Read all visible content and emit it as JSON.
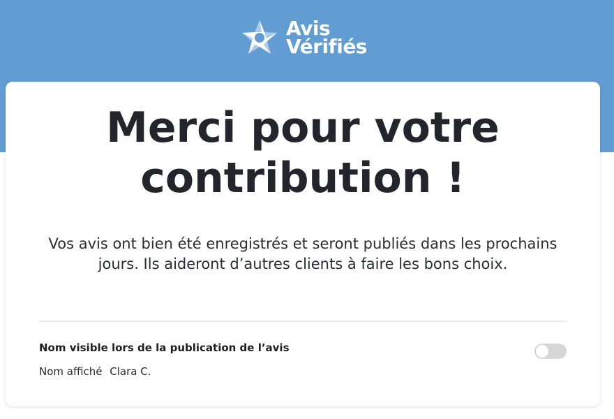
{
  "brand": {
    "logo_line1": "Avis",
    "logo_line2": "Vérifiés",
    "banner_color": "#619dd3",
    "logo_icon": "star-icon"
  },
  "card": {
    "title": "Merci pour votre contribution !",
    "subtitle": "Vos avis ont bien été enregistrés et seront publiés dans les prochains jours. Ils aideront d’autres clients à faire les bons choix."
  },
  "name_settings": {
    "label": "Nom visible lors de la publication de l’avis",
    "display_label": "Nom affiché",
    "display_value": "Clara C.",
    "toggle_state": "off"
  }
}
